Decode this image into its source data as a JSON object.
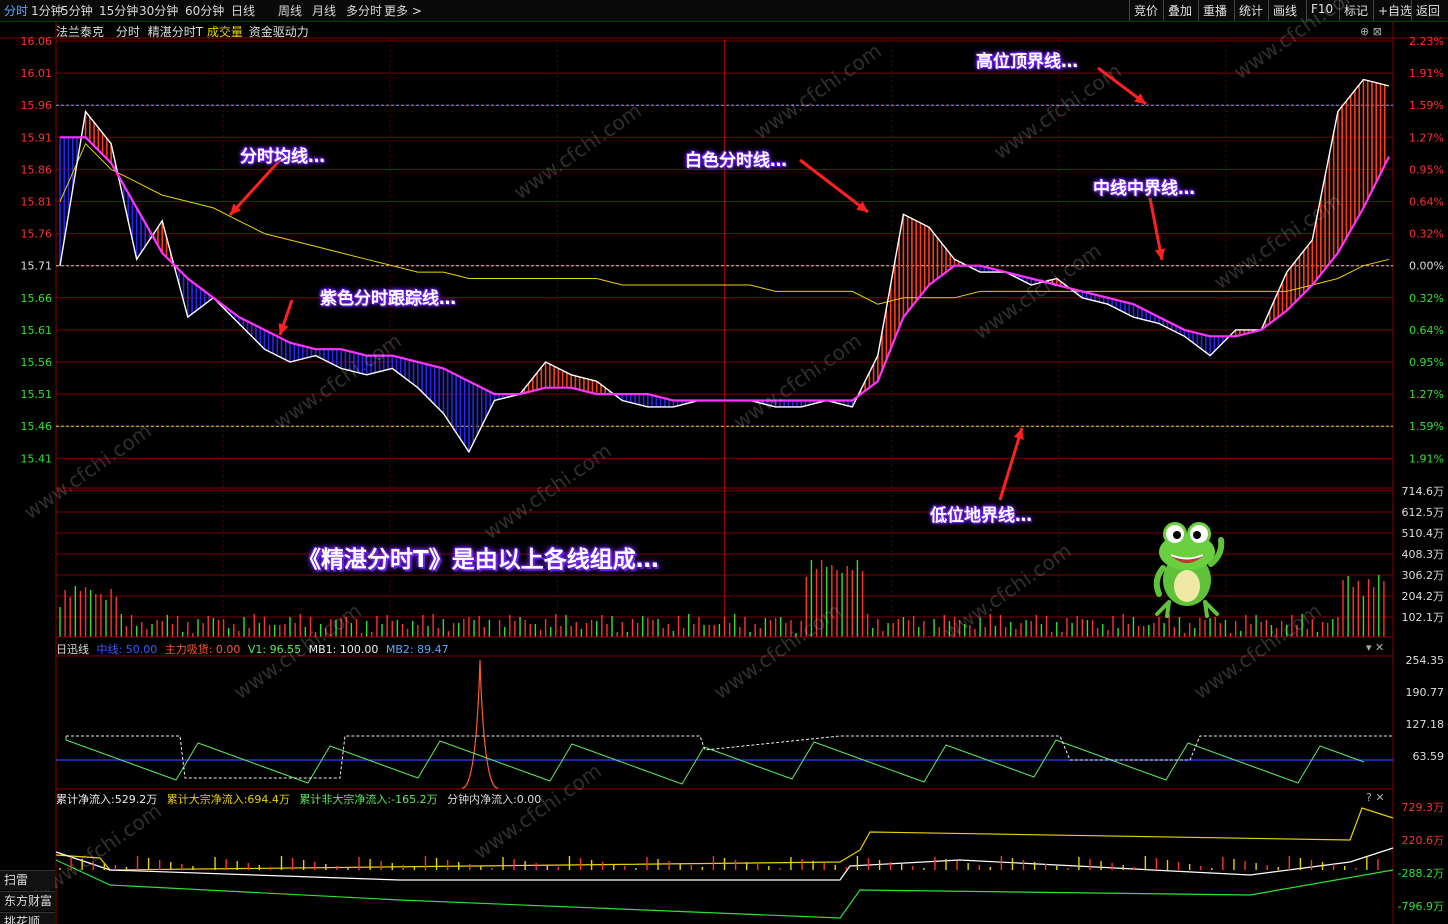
{
  "tabs": [
    "分时",
    "1分钟",
    "5分钟",
    "15分钟",
    "30分钟",
    "60分钟",
    "日线",
    "周线",
    "月线",
    "多分时",
    "更多 >"
  ],
  "right_buttons": [
    "竞价",
    "叠加",
    "重播",
    "统计",
    "画线",
    "F10",
    "标记",
    "+自选",
    "返回"
  ],
  "info": {
    "stock": "法兰泰克",
    "period": "分时",
    "indicator": "精湛分时T",
    "volume": "成交量",
    "flow": "资金驱动力"
  },
  "price_axis": [
    "16.06",
    "16.01",
    "15.96",
    "15.91",
    "15.86",
    "15.81",
    "15.76",
    "15.71",
    "15.66",
    "15.61",
    "15.56",
    "15.51",
    "15.46",
    "15.41"
  ],
  "pct_axis": [
    "2.23%",
    "1.91%",
    "1.59%",
    "1.27%",
    "0.95%",
    "0.64%",
    "0.32%",
    "0.00%",
    "0.32%",
    "0.64%",
    "0.95%",
    "1.27%",
    "1.59%",
    "1.91%"
  ],
  "vol_axis": [
    "714.6万",
    "612.5万",
    "510.4万",
    "408.3万",
    "306.2万",
    "204.2万",
    "102.1万"
  ],
  "annotations": {
    "avg_line": "分时均线…",
    "white_line": "白色分时线…",
    "high_line": "高位顶界线…",
    "mid_line": "中线中界线…",
    "purple_line": "紫色分时跟踪线…",
    "low_line": "低位地界线…",
    "big": "《精湛分时T》是由以上各线组成…"
  },
  "panel2": {
    "name": "日迅线",
    "mid": "中线: 50.00",
    "main": "主力吸货: 0.00",
    "v1": "V1: 96.55",
    "mb1": "MB1: 100.00",
    "mb2": "MB2: 89.47",
    "axis": [
      "254.35",
      "190.77",
      "127.18",
      "63.59"
    ]
  },
  "panel3": {
    "cum": "累计净流入:529.2万",
    "big": "累计大宗净流入:694.4万",
    "small": "累计非大宗净流入:-165.2万",
    "minute": "分钟内净流入:0.00",
    "axis": [
      "729.3万",
      "220.6万",
      "-288.2万",
      "-796.9万"
    ]
  },
  "side": [
    "扫雷",
    "东方财富",
    "挑花顺"
  ],
  "watermark": "www.cfchi.com",
  "chart_data": {
    "type": "line",
    "x_label": "",
    "price_ylim": [
      15.36,
      16.06
    ],
    "prev_close": 15.71,
    "high_line": 15.96,
    "low_line": 15.46,
    "series": [
      {
        "name": "白色分时线",
        "values": [
          15.71,
          15.95,
          15.9,
          15.72,
          15.78,
          15.63,
          15.66,
          15.62,
          15.58,
          15.56,
          15.57,
          15.55,
          15.54,
          15.55,
          15.52,
          15.48,
          15.42,
          15.5,
          15.51,
          15.56,
          15.54,
          15.53,
          15.5,
          15.49,
          15.49,
          15.5,
          15.5,
          15.5,
          15.49,
          15.49,
          15.5,
          15.49,
          15.57,
          15.79,
          15.77,
          15.72,
          15.7,
          15.7,
          15.68,
          15.69,
          15.66,
          15.65,
          15.63,
          15.62,
          15.6,
          15.57,
          15.61,
          15.61,
          15.7,
          15.75,
          15.95,
          16.0,
          15.99
        ]
      },
      {
        "name": "紫色分时跟踪线",
        "values": [
          15.91,
          15.91,
          15.87,
          15.8,
          15.73,
          15.69,
          15.66,
          15.63,
          15.61,
          15.59,
          15.58,
          15.58,
          15.57,
          15.57,
          15.56,
          15.55,
          15.53,
          15.51,
          15.51,
          15.52,
          15.52,
          15.51,
          15.51,
          15.51,
          15.5,
          15.5,
          15.5,
          15.5,
          15.5,
          15.5,
          15.5,
          15.5,
          15.53,
          15.63,
          15.68,
          15.71,
          15.71,
          15.7,
          15.69,
          15.68,
          15.67,
          15.66,
          15.65,
          15.63,
          15.61,
          15.6,
          15.6,
          15.61,
          15.64,
          15.68,
          15.73,
          15.8,
          15.88
        ]
      },
      {
        "name": "分时均线",
        "values": [
          15.81,
          15.9,
          15.86,
          15.84,
          15.82,
          15.81,
          15.8,
          15.78,
          15.76,
          15.75,
          15.74,
          15.73,
          15.72,
          15.71,
          15.7,
          15.7,
          15.69,
          15.69,
          15.69,
          15.69,
          15.69,
          15.69,
          15.68,
          15.68,
          15.68,
          15.68,
          15.68,
          15.68,
          15.67,
          15.67,
          15.67,
          15.67,
          15.65,
          15.66,
          15.66,
          15.66,
          15.67,
          15.67,
          15.67,
          15.67,
          15.67,
          15.67,
          15.67,
          15.67,
          15.67,
          15.67,
          15.67,
          15.67,
          15.67,
          15.68,
          15.69,
          15.71,
          15.72
        ]
      }
    ]
  }
}
